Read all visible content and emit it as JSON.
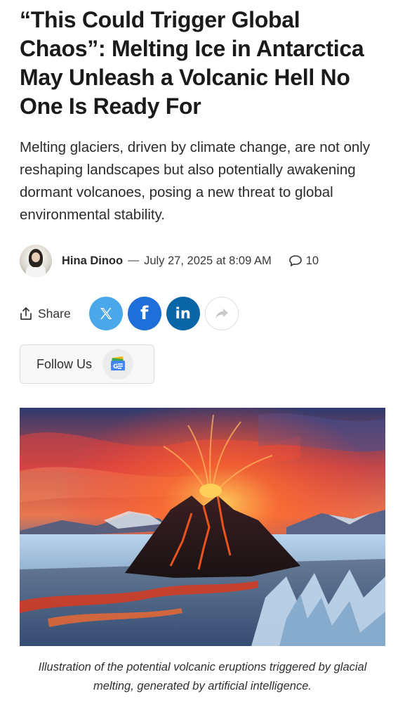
{
  "article": {
    "headline": "“This Could Trigger Global Chaos”: Melting Ice in Antarctica May Unleash a Volcanic Hell No One Is Ready For",
    "dek": "Melting glaciers, driven by climate change, are not only reshaping landscapes but also potentially awakening dormant volcanoes, posing a new threat to global environmental stability.",
    "author": "Hina Dinoo",
    "separator": "—",
    "date": "July 27, 2025 at 8:09 AM",
    "comment_count": "10",
    "caption": "Illustration of the potential volcanic eruptions triggered by glacial melting, generated by artificial intelligence."
  },
  "share": {
    "label": "Share",
    "buttons": [
      {
        "name": "x",
        "glyph": "𝕏",
        "color": "#4aa8ea"
      },
      {
        "name": "facebook",
        "glyph": "f",
        "color": "#1e6fd9"
      },
      {
        "name": "linkedin",
        "glyph": "in",
        "color": "#0b66a8"
      },
      {
        "name": "more-share",
        "icon": "forward-arrow-icon",
        "color": "#ffffff"
      }
    ]
  },
  "follow": {
    "label": "Follow Us",
    "icon": "google-news-icon"
  },
  "icons": {
    "avatar": "author-avatar",
    "comment": "speech-bubble-icon",
    "share": "share-upload-icon"
  }
}
